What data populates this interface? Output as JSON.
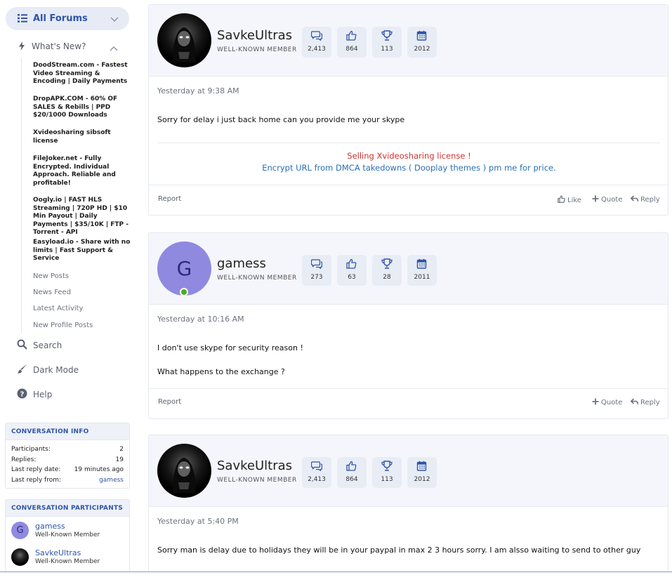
{
  "sidebar": {
    "all_forums": "All Forums",
    "whats_new": "What's New?",
    "featured": [
      "DoodStream.com - Fastest Video Streaming & Encoding | Daily Payments",
      "DropAPK.COM - 60% OF SALES & Rebills | PPD $20/1000 Downloads",
      "Xvideosharing sibsoft license",
      "FileJoker.net - Fully Encrypted. Individual Approach. Reliable and profitable!",
      "Oogly.io | FAST HLS Streaming | 720P HD | $10 Min Payout | Daily Payments | $35/10K | FTP - Torrent - API",
      "Easyload.io - Share with no limits | Fast Support & Service"
    ],
    "subnav": [
      "New Posts",
      "News Feed",
      "Latest Activity",
      "New Profile Posts"
    ],
    "search": "Search",
    "dark_mode": "Dark Mode",
    "help": "Help"
  },
  "conversation_info": {
    "title": "CONVERSATION INFO",
    "participants_label": "Participants:",
    "participants_value": "2",
    "replies_label": "Replies:",
    "replies_value": "19",
    "last_reply_date_label": "Last reply date:",
    "last_reply_date_value": "19 minutes ago",
    "last_reply_from_label": "Last reply from:",
    "last_reply_from_value": "gamess"
  },
  "conversation_participants": {
    "title": "CONVERSATION PARTICIPANTS",
    "items": [
      {
        "initial": "G",
        "name": "gamess",
        "title": "Well-Known Member"
      },
      {
        "initial": "",
        "name": "SavkeUltras",
        "title": "Well-Known Member"
      }
    ]
  },
  "messages": [
    {
      "username": "SavkeUltras",
      "user_title": "WELL-KNOWN MEMBER",
      "stats": [
        "2,413",
        "864",
        "113",
        "2012"
      ],
      "date": "Yesterday at 9:38 AM",
      "text": [
        "Sorry for delay i just back home can you provide me your skype"
      ],
      "signature": [
        "Selling Xvideosharing license !",
        "Encrypt URL from DMCA takedowns ( Dooplay themes ) pm me for price."
      ],
      "report": "Report",
      "like": "Like",
      "quote": "Quote",
      "reply": "Reply"
    },
    {
      "username": "gamess",
      "avatar_initial": "G",
      "user_title": "WELL-KNOWN MEMBER",
      "stats": [
        "273",
        "63",
        "28",
        "2011"
      ],
      "date": "Yesterday at 10:16 AM",
      "text": [
        "I don't use skype for security reason !",
        "What happens to the exchange ?"
      ],
      "report": "Report",
      "quote": "Quote",
      "reply": "Reply"
    },
    {
      "username": "SavkeUltras",
      "user_title": "WELL-KNOWN MEMBER",
      "stats": [
        "2,413",
        "864",
        "113",
        "2012"
      ],
      "date": "Yesterday at 5:40 PM",
      "text": [
        "Sorry man is delay due to holidays they will be in your paypal in max 2 3 hours sorry. I am alsso waiting to send to other guy"
      ]
    }
  ],
  "colors": {
    "accent": "#2f55a6",
    "signature_red": "#d0302e",
    "signature_blue": "#2a6fb4",
    "online": "#4caf15",
    "avatar_letter_bg": "#8f8ae0"
  }
}
